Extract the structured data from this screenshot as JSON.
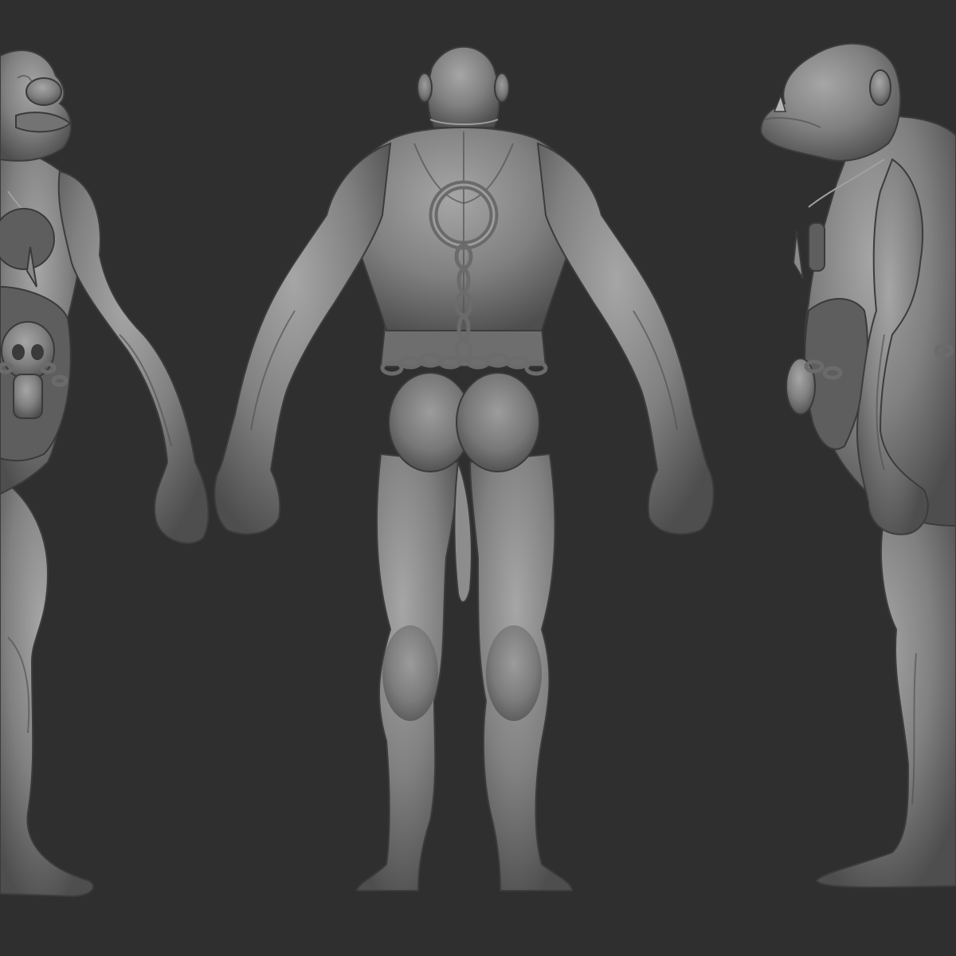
{
  "scene": {
    "background": "#2f2f2f",
    "material_color": "#8a8a8a",
    "views": [
      "front-three-quarter",
      "back",
      "side"
    ]
  }
}
